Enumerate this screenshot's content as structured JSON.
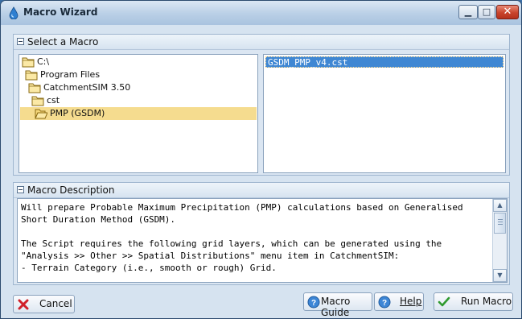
{
  "window": {
    "title": "Macro Wizard"
  },
  "select_group": {
    "title": "Select a Macro"
  },
  "tree": [
    {
      "label": "C:\\",
      "level": 0
    },
    {
      "label": "Program Files",
      "level": 1
    },
    {
      "label": "CatchmentSIM 3.50",
      "level": 2
    },
    {
      "label": "cst",
      "level": 3
    },
    {
      "label": "PMP (GSDM)",
      "level": 4,
      "selected": true
    }
  ],
  "files": [
    "GSDM_PMP_v4.cst"
  ],
  "desc_group": {
    "title": "Macro Description"
  },
  "description": "Will prepare Probable Maximum Precipitation (PMP) calculations based on Generalised\nShort Duration Method (GSDM).\n\nThe Script requires the following grid layers, which can be generated using the\n\"Analysis >> Other >> Spatial Distributions\" menu item in CatchmentSIM:\n- Terrain Category (i.e., smooth or rough) Grid.",
  "buttons": {
    "cancel": "Cancel",
    "macro_guide": "Macro Guide",
    "help": "Help",
    "run": "Run Macro"
  },
  "colors": {
    "selection_highlight": "#f5dc8f",
    "file_selected": "#3f87d3"
  }
}
